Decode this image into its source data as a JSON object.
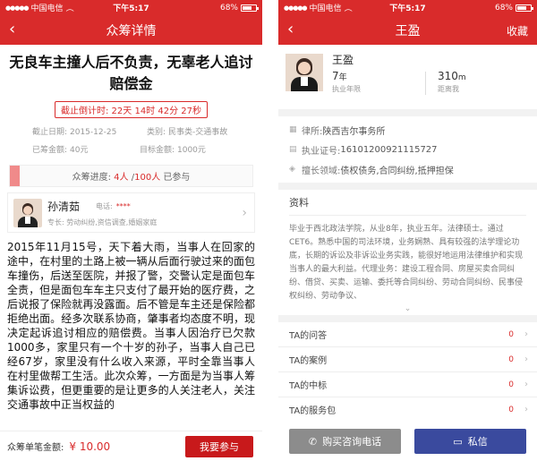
{
  "status": {
    "carrier": "中国电信",
    "time": "下午5:17",
    "battery": "68%",
    "battery_level": 0.68
  },
  "left": {
    "nav_title": "众筹详情",
    "title": "无良车主撞人后不负责，无辜老人追讨赔偿金",
    "countdown": "截止倒计时: 22天 14时 42分 27秒",
    "rows": [
      {
        "k1": "截止日期:",
        "v1": "2015-12-25",
        "k2": "类别:",
        "v2": "民事类-交通事故"
      },
      {
        "k1": "已筹金额:",
        "v1": "40元",
        "k2": "目标金额:",
        "v2": "1000元"
      }
    ],
    "progress": {
      "prefix": "众筹进度: ",
      "count": "4人",
      "sep": " /",
      "total": "100人",
      "suffix": " 已参与",
      "fraction": 0.04
    },
    "lawyer": {
      "name": "孙清茹",
      "phone_label": "电话:",
      "phone_value": "****",
      "specialty": "专长: 劳动纠纷,资信调查,婚姻家庭"
    },
    "story": "2015年11月15号，天下着大雨，当事人在回家的途中，在村里的土路上被一辆从后面行驶过来的面包车撞伤，后送至医院，并报了警，交警认定是面包车全责，但是面包车车主只支付了最开始的医疗费，之后说报了保险就再没露面。后不管是车主还是保险都拒绝出面。经多次联系协商，肇事者均态度不明，现决定起诉追讨相应的赔偿费。当事人因治疗已欠款1000多，家里只有一个十岁的孙子，当事人自己已经67岁，家里没有什么收入来源，平时全靠当事人在村里做帮工生活。此次众筹，一方面是为当事人筹集诉讼费，但更重要的是让更多的人关注老人，关注交通事故中正当权益的",
    "amount_label": "众筹单笔金额:",
    "amount_value": "¥ 10.00",
    "join_button": "我要参与"
  },
  "right": {
    "nav_title": "王盈",
    "favorite": "收藏",
    "name": "王盈",
    "years": "7",
    "years_unit": "年",
    "years_label": "执业年限",
    "distance": "310",
    "distance_unit": "m",
    "distance_label": "距离我",
    "firm_label": "律所: ",
    "firm": "陕西吉尔事务所",
    "license_label": "执业证号: ",
    "license": "16101200921115727",
    "areas_label": "擅长领域: ",
    "areas": "债权债务,合同纠纷,抵押担保",
    "bio_title": "资料",
    "bio": "毕业于西北政法学院，从业8年，执业五年。法律硕士。通过CET6。熟悉中国的司法环境，业务娴熟、具有较强的法学理论功底，长期的诉讼及非诉讼业务实践，能很好地运用法律维护和实现当事人的最大利益。代理业务：建设工程合同、房屋买卖合同纠纷、借贷、买卖、运输、委托等合同纠纷、劳动合同纠纷、民事侵权纠纷、劳动争议、",
    "list": [
      {
        "label": "TA的问答",
        "count": "0"
      },
      {
        "label": "TA的案例",
        "count": "0"
      },
      {
        "label": "TA的中标",
        "count": "0"
      },
      {
        "label": "TA的服务包",
        "count": "0"
      }
    ],
    "call_button": "购买咨询电话",
    "msg_button": "私信"
  }
}
